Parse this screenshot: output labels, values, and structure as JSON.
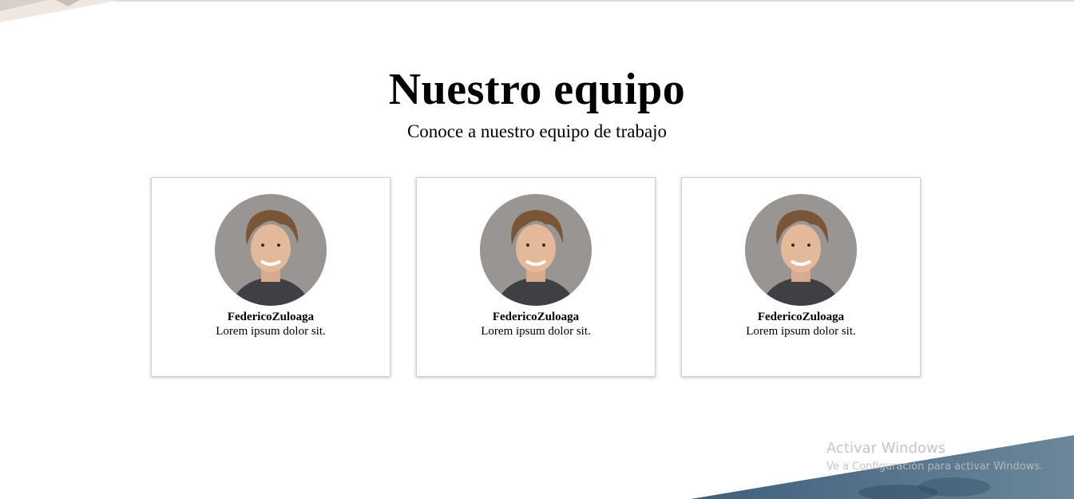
{
  "page": {
    "title": "Nuestro equipo",
    "subtitle": "Conoce a nuestro equipo de trabajo"
  },
  "team": [
    {
      "name": "FedericoZuloaga",
      "description": "Lorem ipsum dolor sit."
    },
    {
      "name": "FedericoZuloaga",
      "description": "Lorem ipsum dolor sit."
    },
    {
      "name": "FedericoZuloaga",
      "description": "Lorem ipsum dolor sit."
    }
  ],
  "watermark": {
    "title": "Activar Windows",
    "subtitle": "Ve a Configuración para activar Windows."
  },
  "colors": {
    "card_border": "#d2d2d2",
    "corner_decoration": "#5b7891",
    "watermark_text": "#bebec3"
  }
}
